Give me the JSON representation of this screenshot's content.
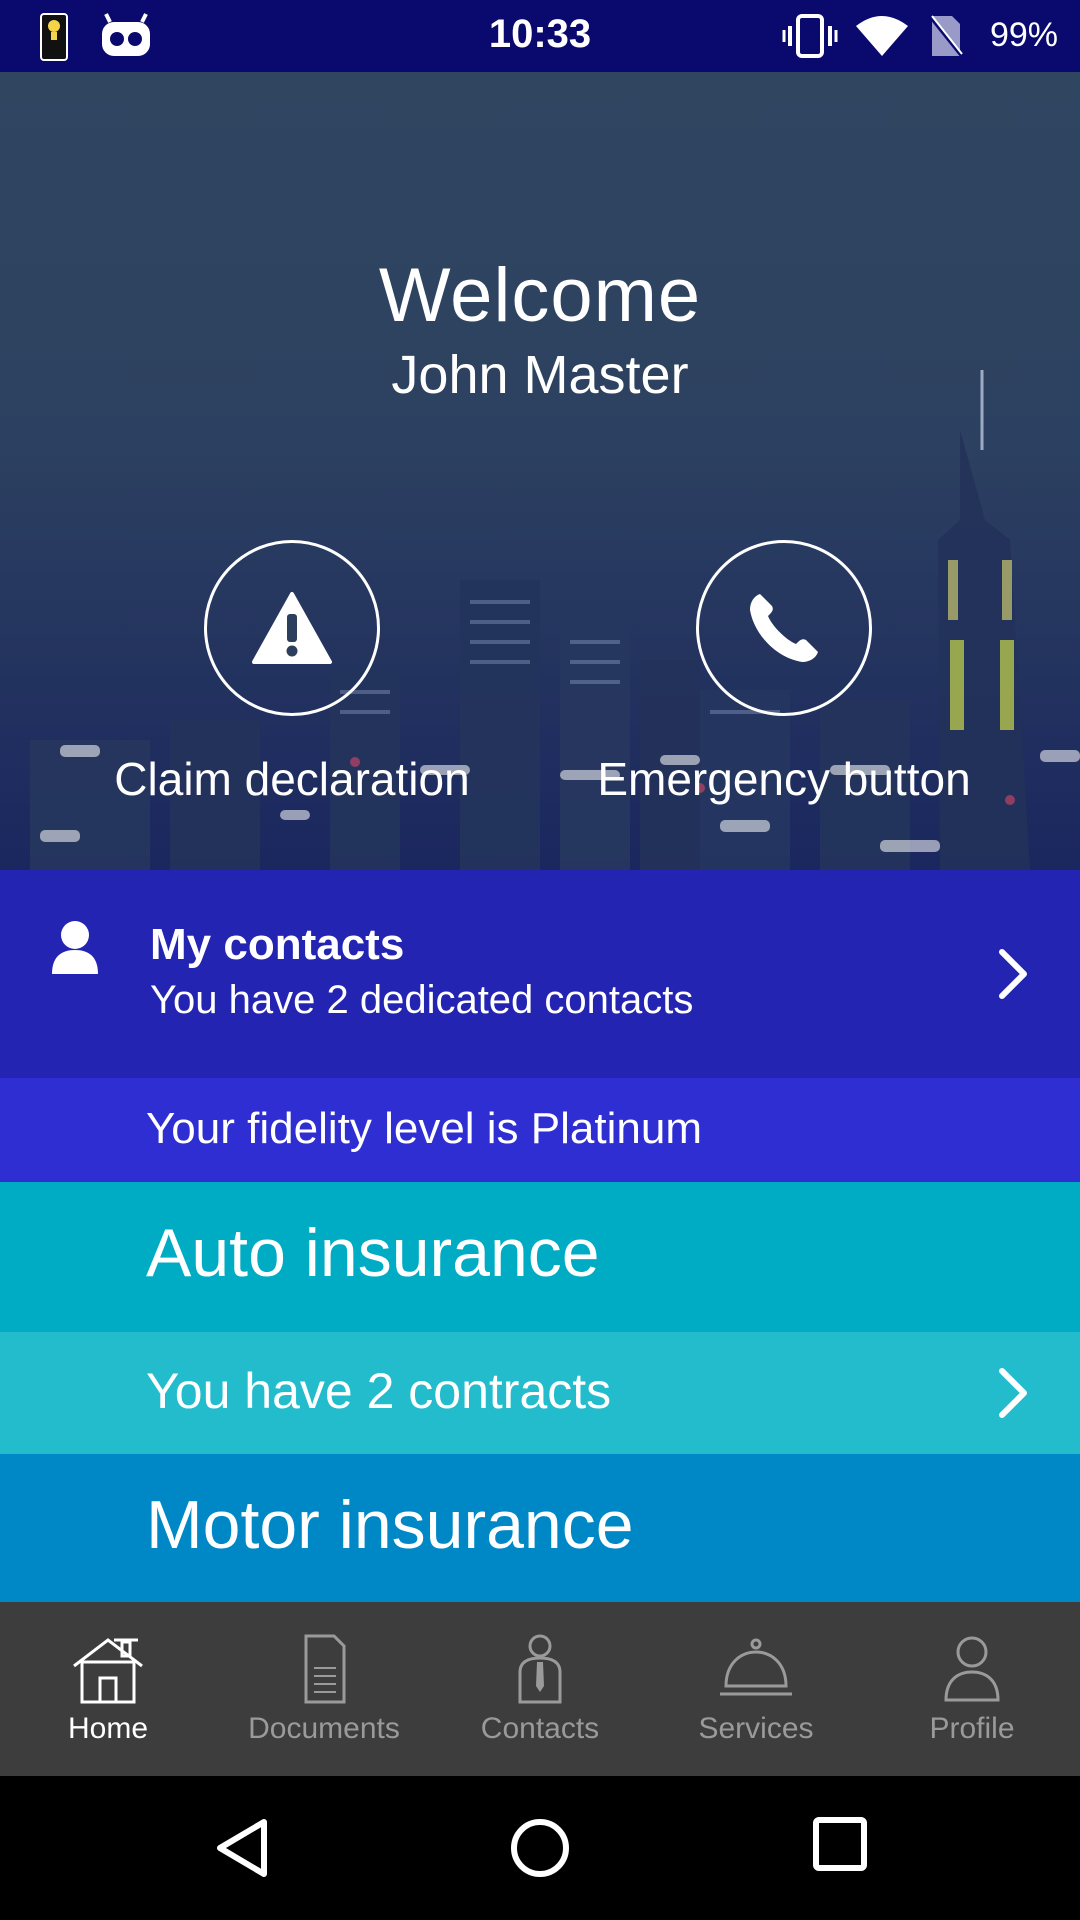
{
  "status_bar": {
    "time": "10:33",
    "battery": "99%",
    "icons": [
      "flashlight-notification-icon",
      "app-notification-icon",
      "vibrate-icon",
      "wifi-icon",
      "no-sim-icon"
    ]
  },
  "hero": {
    "welcome": "Welcome",
    "user_name": "John Master",
    "actions": [
      {
        "label": "Claim declaration",
        "icon": "warning-icon"
      },
      {
        "label": "Emergency button",
        "icon": "phone-icon"
      }
    ]
  },
  "contacts": {
    "title": "My contacts",
    "subtitle": "You have 2 dedicated contacts",
    "icon": "person-icon"
  },
  "fidelity": {
    "text": "Your fidelity level is Platinum"
  },
  "auto": {
    "title": "Auto insurance",
    "contracts": "You have 2 contracts"
  },
  "motor": {
    "title": "Motor insurance"
  },
  "bottom_nav": {
    "items": [
      {
        "label": "Home",
        "icon": "house-icon",
        "active": true
      },
      {
        "label": "Documents",
        "icon": "document-icon",
        "active": false
      },
      {
        "label": "Contacts",
        "icon": "contact-person-icon",
        "active": false
      },
      {
        "label": "Services",
        "icon": "service-bell-icon",
        "active": false
      },
      {
        "label": "Profile",
        "icon": "profile-icon",
        "active": false
      }
    ]
  },
  "colors": {
    "status_bar": "#0a0a6e",
    "contacts": "#2424b2",
    "fidelity": "#2f2ed2",
    "auto": "#00acc4",
    "contracts": "#22bccd",
    "motor": "#0088c6",
    "bottom_nav": "#3d3d3d"
  }
}
